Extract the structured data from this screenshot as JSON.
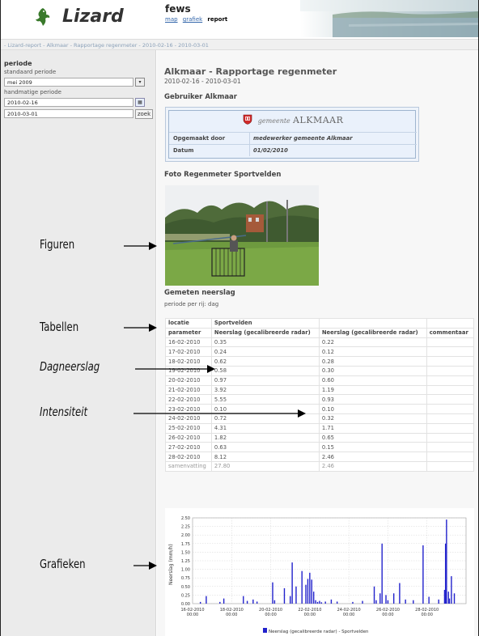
{
  "header": {
    "logo_text": "Lizard",
    "app_title": "fews",
    "nav": [
      "map",
      "grafiek"
    ],
    "nav_active": "report"
  },
  "breadcrumb": "- Lizard-report - Alkmaar - Rapportage regenmeter - 2010-02-16 - 2010-03-01",
  "sidebar": {
    "title": "periode",
    "standard_label": "standaard periode",
    "standard_value": "mei 2009",
    "manual_label": "handmatige periode",
    "date_from": "2010-02-16",
    "date_to": "2010-03-01",
    "search_button": "zoek"
  },
  "report": {
    "title": "Alkmaar - Rapportage regenmeter",
    "date_range": "2010-02-16 - 2010-03-01",
    "user_heading": "Gebruiker Alkmaar",
    "gemeente_prefix": "gemeente",
    "gemeente_name": "ALKMAAR",
    "made_by_label": "Opgemaakt door",
    "made_by_value": "medewerker gemeente Alkmaar",
    "date_label": "Datum",
    "date_value": "01/02/2010",
    "photo_heading": "Foto Regenmeter Sportvelden",
    "measured_heading": "Gemeten neerslag",
    "period_note": "periode per rij: dag"
  },
  "table": {
    "location_label": "locatie",
    "location_value": "Sportvelden",
    "headers": [
      "parameter",
      "Neerslag (gecalibreerde radar)",
      "Neerslag (gecalibreerde radar)",
      "commentaar"
    ],
    "rows": [
      [
        "16-02-2010",
        "0.35",
        "0.22"
      ],
      [
        "17-02-2010",
        "0.24",
        "0.12"
      ],
      [
        "18-02-2010",
        "0.62",
        "0.28"
      ],
      [
        "19-02-2010",
        "0.58",
        "0.30"
      ],
      [
        "20-02-2010",
        "0.97",
        "0.60"
      ],
      [
        "21-02-2010",
        "3.92",
        "1.19"
      ],
      [
        "22-02-2010",
        "5.55",
        "0.93"
      ],
      [
        "23-02-2010",
        "0.10",
        "0.10"
      ],
      [
        "24-02-2010",
        "0.72",
        "0.32"
      ],
      [
        "25-02-2010",
        "4.31",
        "1.71"
      ],
      [
        "26-02-2010",
        "1.82",
        "0.65"
      ],
      [
        "27-02-2010",
        "0.63",
        "0.15"
      ],
      [
        "28-02-2010",
        "8.12",
        "2.46"
      ]
    ],
    "summary": [
      "samenvatting",
      "27.80",
      "2.46"
    ]
  },
  "annotations": {
    "figuren": "Figuren",
    "tabellen": "Tabellen",
    "dagneerslag": "Dagneerslag",
    "intensiteit": "Intensiteit",
    "grafieken": "Grafieken"
  },
  "colors": {
    "bar": "#2222cc",
    "sidebar_bg": "#ebebeb",
    "userbox_border": "#9fb5cf",
    "breadcrumb_text": "#8aa0b8"
  },
  "chart_data": {
    "type": "bar",
    "ylabel": "Neerslag (mm/h)",
    "ylim": [
      0,
      2.5
    ],
    "yticks": [
      "0.00",
      "0.25",
      "0.50",
      "0.75",
      "1.00",
      "1.25",
      "1.50",
      "1.75",
      "2.00",
      "2.25",
      "2.50"
    ],
    "xlabels": [
      [
        "16-02-2010",
        "00:00"
      ],
      [
        "18-02-2010",
        "00:00"
      ],
      [
        "20-02-2010",
        "00:00"
      ],
      [
        "22-02-2010",
        "00:00"
      ],
      [
        "24-02-2010",
        "00:00"
      ],
      [
        "26-02-2010",
        "00:00"
      ],
      [
        "28-02-2010",
        "00:00"
      ]
    ],
    "legend": "Neerslag (gecalibreerde radar) - Sportvelden",
    "grid": true,
    "series": [
      {
        "name": "Neerslag (gecalibreerde radar) - Sportvelden",
        "x_day": [
          0.4,
          0.7,
          1.4,
          1.6,
          2.6,
          2.8,
          3.1,
          3.3,
          4.1,
          4.2,
          4.7,
          5.0,
          5.1,
          5.3,
          5.6,
          5.8,
          5.9,
          6.0,
          6.1,
          6.2,
          6.3,
          6.4,
          6.5,
          6.6,
          6.8,
          7.1,
          7.4,
          8.2,
          8.7,
          9.3,
          9.4,
          9.6,
          9.7,
          9.9,
          10.0,
          10.3,
          10.6,
          10.9,
          11.3,
          11.8,
          12.1,
          12.6,
          12.9,
          12.95,
          13.0,
          13.1,
          13.15,
          13.25,
          13.4
        ],
        "values": [
          0.05,
          0.22,
          0.05,
          0.15,
          0.22,
          0.08,
          0.12,
          0.06,
          0.62,
          0.1,
          0.45,
          0.22,
          1.2,
          0.5,
          0.95,
          0.55,
          0.72,
          0.9,
          0.7,
          0.35,
          0.1,
          0.05,
          0.08,
          0.04,
          0.06,
          0.12,
          0.06,
          0.05,
          0.08,
          0.5,
          0.1,
          0.3,
          1.75,
          0.25,
          0.1,
          0.3,
          0.6,
          0.12,
          0.1,
          1.7,
          0.2,
          0.12,
          0.4,
          1.75,
          2.45,
          0.35,
          0.15,
          0.8,
          0.3
        ]
      }
    ]
  }
}
